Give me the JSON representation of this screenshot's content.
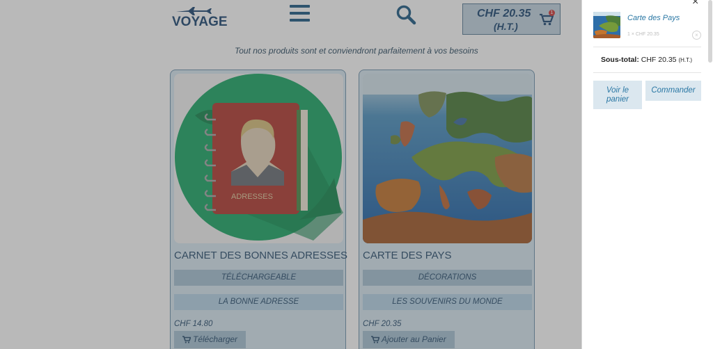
{
  "header": {
    "logo_text": "VOYAGE",
    "cart_amount": "CHF 20.35",
    "cart_ht": "(H.T.)",
    "cart_badge": "1"
  },
  "tagline": "Tout nos produits sont  et conviendront parfaitement à vos besoins",
  "products": [
    {
      "title": "CARNET DES BONNES ADRESSES",
      "category_1": "TÉLÉCHARGEABLE",
      "category_2": "LA BONNE ADRESSE",
      "price": "CHF 14.80",
      "action_label": "Télécharger",
      "book_label": "ADRESSES"
    },
    {
      "title": "CARTE DES PAYS",
      "category_1": "DÉCORATIONS",
      "category_2": "LES SOUVENIRS DU MONDE",
      "price": "CHF 20.35",
      "action_label": "Ajouter au Panier"
    }
  ],
  "mini_cart": {
    "close_label": "×",
    "item_name": "Carte des Pays",
    "item_qty": "1 × CHF 20.35",
    "remove_label": "×",
    "subtotal_label": "Sous-total:",
    "subtotal_value": "CHF 20.35",
    "subtotal_ht": "(H.T.)",
    "view_cart_label_1": "Voir le",
    "view_cart_label_2": "panier",
    "order_label": "Commander"
  },
  "colors": {
    "brand": "#1f4a75",
    "accent": "#2a77a4",
    "badge": "#d23d3d"
  }
}
